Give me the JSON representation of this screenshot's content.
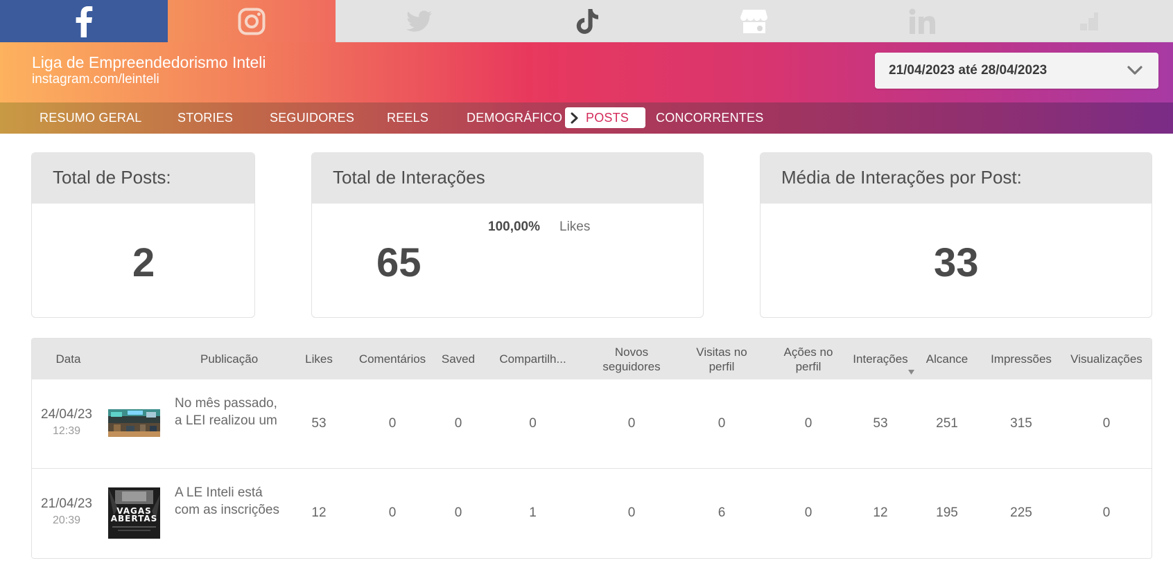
{
  "social_tabs": [
    {
      "name": "facebook",
      "icon": "facebook-icon"
    },
    {
      "name": "instagram",
      "icon": "instagram-icon"
    },
    {
      "name": "twitter",
      "icon": "twitter-icon"
    },
    {
      "name": "tiktok",
      "icon": "tiktok-icon"
    },
    {
      "name": "google-business",
      "icon": "storefront-icon"
    },
    {
      "name": "linkedin",
      "icon": "linkedin-icon"
    },
    {
      "name": "other",
      "icon": "chart-steps-icon"
    }
  ],
  "header": {
    "account_name": "Liga de Empreendedorismo Inteli",
    "account_url": "instagram.com/leinteli",
    "date_range": "21/04/2023 até 28/04/2023"
  },
  "nav": {
    "items": [
      "RESUMO GERAL",
      "STORIES",
      "SEGUIDORES",
      "REELS",
      "DEMOGRÁFICO",
      "POSTS",
      "CONCORRENTES"
    ],
    "active": "POSTS"
  },
  "cards": {
    "total_posts": {
      "title": "Total de Posts:",
      "value": "2"
    },
    "total_interactions": {
      "title": "Total de Interações",
      "value": "65",
      "breakdown_pct": "100,00%",
      "breakdown_label": "Likes"
    },
    "avg_interactions": {
      "title": "Média de Interações por Post:",
      "value": "33"
    }
  },
  "table": {
    "headers": {
      "data": "Data",
      "publicacao": "Publicação",
      "likes": "Likes",
      "comentarios": "Comentários",
      "saved": "Saved",
      "compartilhamentos": "Compartilh...",
      "novos_seguidores": "Novos seguidores",
      "visitas_perfil": "Visitas no perfil",
      "acoes_perfil": "Ações no perfil",
      "interacoes": "Interações",
      "alcance": "Alcance",
      "impressoes": "Impressões",
      "visualizacoes": "Visualizações"
    },
    "sorted_column": "interacoes",
    "rows": [
      {
        "date": "24/04/23",
        "time": "12:39",
        "caption": "No mês passado, a LEI realizou um",
        "likes": "53",
        "comentarios": "0",
        "saved": "0",
        "compartilhamentos": "0",
        "novos_seguidores": "0",
        "visitas_perfil": "0",
        "acoes_perfil": "0",
        "interacoes": "53",
        "alcance": "251",
        "impressoes": "315",
        "visualizacoes": "0"
      },
      {
        "date": "21/04/23",
        "time": "20:39",
        "caption": "A LE Inteli está com as inscrições",
        "thumb_text": "VAGAS ABERTAS",
        "likes": "12",
        "comentarios": "0",
        "saved": "0",
        "compartilhamentos": "1",
        "novos_seguidores": "0",
        "visitas_perfil": "6",
        "acoes_perfil": "0",
        "interacoes": "12",
        "alcance": "195",
        "impressoes": "225",
        "visualizacoes": "0"
      }
    ]
  },
  "colors": {
    "facebook": "#3b5b9c",
    "active_nav_text": "#d42a5a",
    "card_header_bg": "#e6e6e6"
  }
}
